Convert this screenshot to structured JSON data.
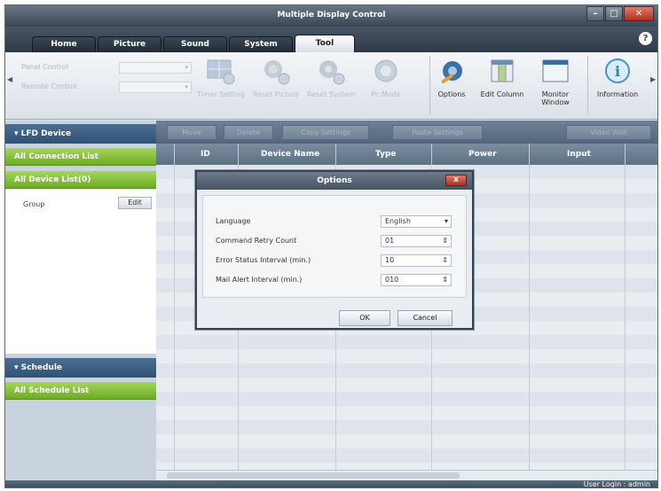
{
  "window": {
    "title": "Multiple Display Control"
  },
  "menu_tabs": [
    "Home",
    "Picture",
    "Sound",
    "System",
    "Tool"
  ],
  "active_tab": "Tool",
  "ribbon": {
    "left_labels": [
      "Panel Control",
      "Remote Control"
    ],
    "buttons": [
      {
        "label": "Timer Setting",
        "icon": "timer-monitor-icon",
        "enabled": false
      },
      {
        "label": "Reset Picture",
        "icon": "reset-picture-icon",
        "enabled": false
      },
      {
        "label": "Reset System",
        "icon": "reset-system-icon",
        "enabled": false
      },
      {
        "label": "Pc Mode",
        "icon": "pc-mode-icon",
        "enabled": false
      },
      {
        "label": "Options",
        "icon": "options-icon",
        "enabled": true
      },
      {
        "label": "Edit Column",
        "icon": "edit-column-icon",
        "enabled": true
      },
      {
        "label": "Monitor Window",
        "icon": "monitor-window-icon",
        "enabled": true
      },
      {
        "label": "Information",
        "icon": "information-icon",
        "enabled": true
      }
    ]
  },
  "left_panel": {
    "lfd_header": "LFD Device",
    "all_connection_list": "All Connection List",
    "all_device_list": "All Device List(0)",
    "group_label": "Group",
    "edit_label": "Edit",
    "schedule_header": "Schedule",
    "all_schedule_list": "All Schedule List"
  },
  "toolbar2": [
    "Move",
    "Delete",
    "Copy Settings",
    "Paste Settings",
    "Video Wall"
  ],
  "grid_columns": [
    "ID",
    "Device Name",
    "Type",
    "Power",
    "Input"
  ],
  "dialog": {
    "title": "Options",
    "close_label": "x",
    "fields": [
      {
        "label": "Language",
        "value": "English",
        "control": "dropdown"
      },
      {
        "label": "Command Retry Count",
        "value": "01",
        "control": "spinner"
      },
      {
        "label": "Error Status Interval (min.)",
        "value": "10",
        "control": "spinner"
      },
      {
        "label": "Mail Alert Interval (min.)",
        "value": "010",
        "control": "spinner"
      }
    ],
    "ok_label": "OK",
    "cancel_label": "Cancel"
  },
  "status": {
    "user_login": "User Login : admin"
  },
  "help_label": "?"
}
